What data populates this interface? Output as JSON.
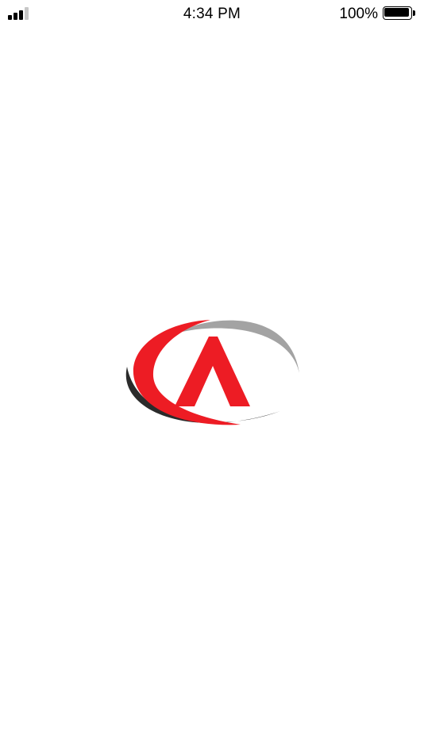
{
  "status_bar": {
    "time": "4:34 PM",
    "battery_percent": "100%",
    "signal_bars_filled": 3,
    "signal_bars_total": 4,
    "battery_level": 1.0
  },
  "splash": {
    "logo_icon": "red-a-swoosh-logo",
    "colors": {
      "brand_red": "#ed1c24",
      "swoosh_gray": "#a3a3a3",
      "swoosh_dark": "#2b2b2b",
      "background": "#ffffff"
    }
  }
}
